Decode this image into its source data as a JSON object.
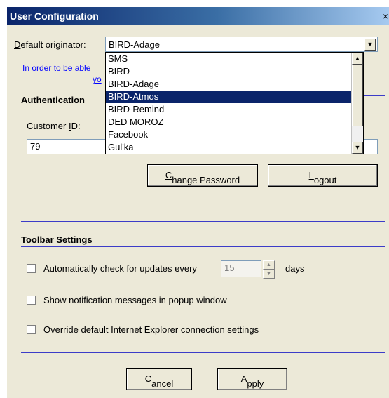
{
  "window": {
    "title": "User Configuration",
    "close_label": "×"
  },
  "originator": {
    "label_prefix": "",
    "label_key": "D",
    "label_rest": "efault originator:",
    "value": "BIRD-Adage",
    "arrow": "▼"
  },
  "info_link": {
    "line1": "In order to be able",
    "line2": "yo"
  },
  "authentication": {
    "title": "Authentication",
    "customer_id_label_prefix": "Customer ",
    "customer_id_label_key": "I",
    "customer_id_label_rest": "D:",
    "customer_id_value": "79",
    "change_password_prefix": "",
    "change_password_key": "C",
    "change_password_rest": "hange Password",
    "logout_prefix": "",
    "logout_key": "L",
    "logout_rest": "ogout"
  },
  "dropdown": {
    "items": [
      "SMS",
      "BIRD",
      "BIRD-Adage",
      "BIRD-Atmos",
      "BIRD-Remind",
      "DED MOROZ",
      "Facebook",
      "Gul'ka"
    ],
    "selected": "BIRD-Atmos",
    "scroll_up": "▲",
    "scroll_down": "▼"
  },
  "toolbar_settings": {
    "title": "Toolbar Settings",
    "auto_update_label": "Automatically check for updates every",
    "auto_update_days": "15",
    "days_label": "days",
    "notify_label": "Show notification messages in popup window",
    "override_label": "Override default Internet Explorer connection settings",
    "spin_up": "▲",
    "spin_down": "▼"
  },
  "footer": {
    "cancel_prefix": "",
    "cancel_key": "C",
    "cancel_rest": "ancel",
    "apply_prefix": "",
    "apply_key": "A",
    "apply_rest": "pply"
  },
  "colors": {
    "title_gradient_start": "#0a246a",
    "selection": "#0a246a",
    "link": "#0000ff",
    "separator": "#3c3cc8",
    "dialog_bg": "#ece9d8"
  }
}
